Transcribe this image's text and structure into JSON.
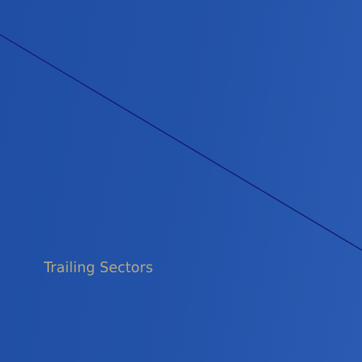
{
  "section": {
    "label": "Trailing Sectors"
  },
  "colors": {
    "background": "#2352a8",
    "divider_line": "#141c6e",
    "label_text": "#b3a982"
  }
}
